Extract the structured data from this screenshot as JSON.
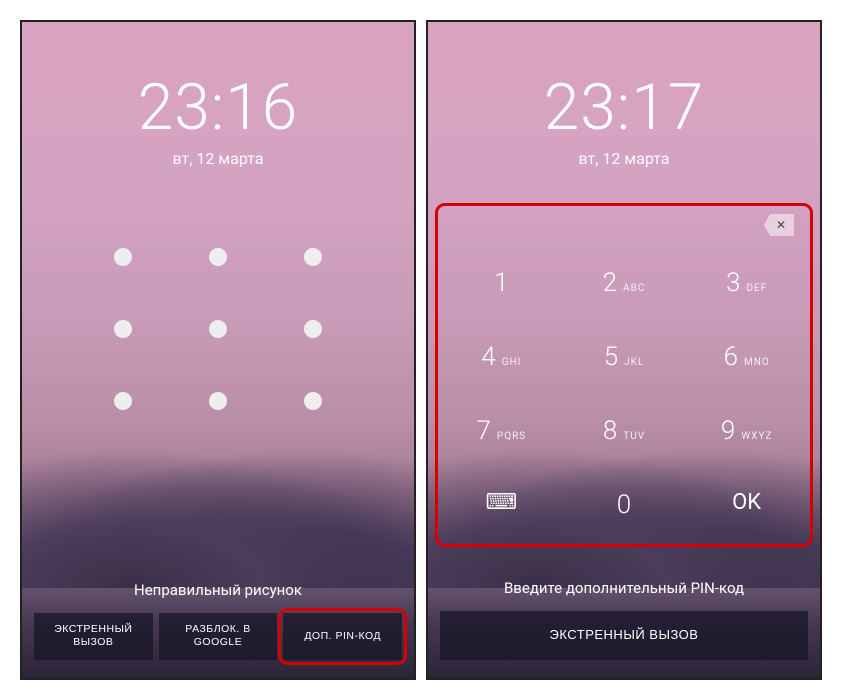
{
  "left": {
    "time": "23:16",
    "date": "вт, 12 марта",
    "message": "Неправильный рисунок",
    "buttons": {
      "emergency": "ЭКСТРЕННЫЙ\nВЫЗОВ",
      "google": "РАЗБЛОК. В\nGOOGLE",
      "pin": "ДОП. PIN-КОД"
    }
  },
  "right": {
    "time": "23:17",
    "date": "вт, 12 марта",
    "message": "Введите дополнительный PIN-код",
    "emergency": "ЭКСТРЕННЫЙ ВЫЗОВ",
    "keypad": [
      {
        "n": "1",
        "l": ""
      },
      {
        "n": "2",
        "l": "ABC"
      },
      {
        "n": "3",
        "l": "DEF"
      },
      {
        "n": "4",
        "l": "GHI"
      },
      {
        "n": "5",
        "l": "JKL"
      },
      {
        "n": "6",
        "l": "MNO"
      },
      {
        "n": "7",
        "l": "PQRS"
      },
      {
        "n": "8",
        "l": "TUV"
      },
      {
        "n": "9",
        "l": "WXYZ"
      },
      {
        "n": "",
        "l": "",
        "icon": "⌨"
      },
      {
        "n": "0",
        "l": ""
      },
      {
        "n": "OK",
        "l": "",
        "ok": true
      }
    ]
  }
}
